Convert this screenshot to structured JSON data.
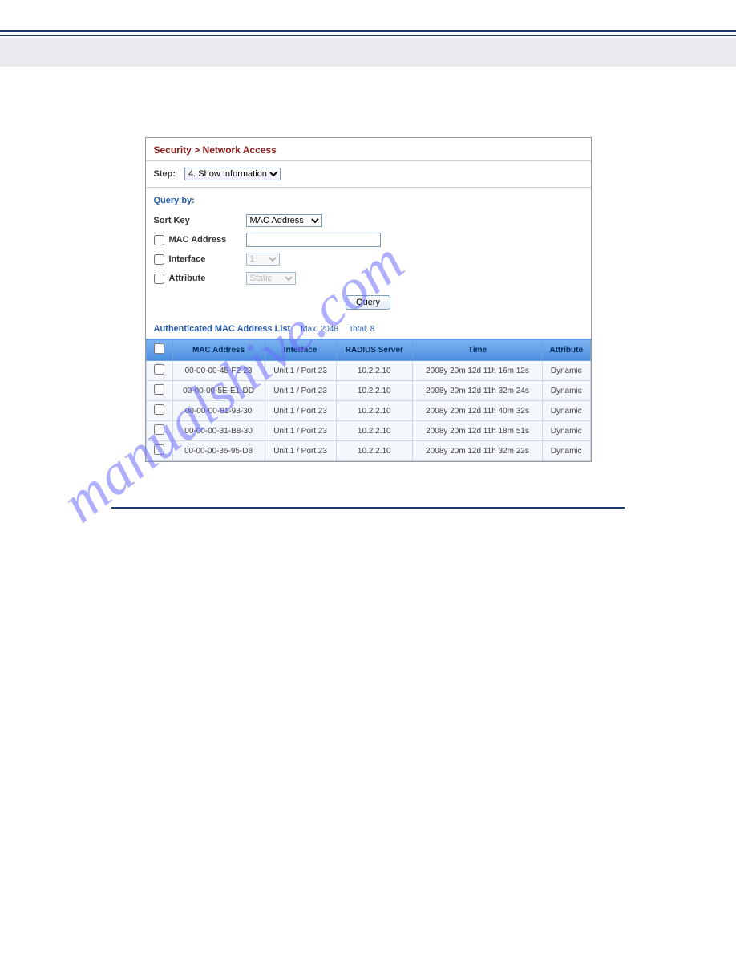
{
  "panel": {
    "title": "Security > Network Access",
    "step": {
      "label": "Step:",
      "selected": "4. Show Information"
    }
  },
  "query": {
    "title": "Query by:",
    "sort_key": {
      "label": "Sort Key",
      "selected": "MAC Address"
    },
    "mac_address": {
      "label": "MAC Address",
      "value": ""
    },
    "interface": {
      "label": "Interface",
      "selected": "1"
    },
    "attribute": {
      "label": "Attribute",
      "selected": "Static"
    },
    "button": "Query"
  },
  "list": {
    "title": "Authenticated MAC Address List",
    "max_label": "Max: 2048",
    "total_label": "Total: 8",
    "headers": {
      "checkbox": "",
      "mac": "MAC Address",
      "iface": "Interface",
      "radius": "RADIUS Server",
      "time": "Time",
      "attr": "Attribute"
    },
    "rows": [
      {
        "mac": "00-00-00-45-F2-23",
        "iface": "Unit 1 / Port 23",
        "radius": "10.2.2.10",
        "time": "2008y 20m 12d 11h 16m 12s",
        "attr": "Dynamic"
      },
      {
        "mac": "00-00-00-5E-E1-DD",
        "iface": "Unit 1 / Port 23",
        "radius": "10.2.2.10",
        "time": "2008y 20m 12d 11h 32m 24s",
        "attr": "Dynamic"
      },
      {
        "mac": "00-00-00-81-93-30",
        "iface": "Unit 1 / Port 23",
        "radius": "10.2.2.10",
        "time": "2008y 20m 12d 11h 40m 32s",
        "attr": "Dynamic"
      },
      {
        "mac": "00-00-00-31-B8-30",
        "iface": "Unit 1 / Port 23",
        "radius": "10.2.2.10",
        "time": "2008y 20m 12d 11h 18m 51s",
        "attr": "Dynamic"
      },
      {
        "mac": "00-00-00-36-95-D8",
        "iface": "Unit 1 / Port 23",
        "radius": "10.2.2.10",
        "time": "2008y 20m 12d 11h 32m 22s",
        "attr": "Dynamic"
      }
    ]
  },
  "watermark": "manualshive.com"
}
